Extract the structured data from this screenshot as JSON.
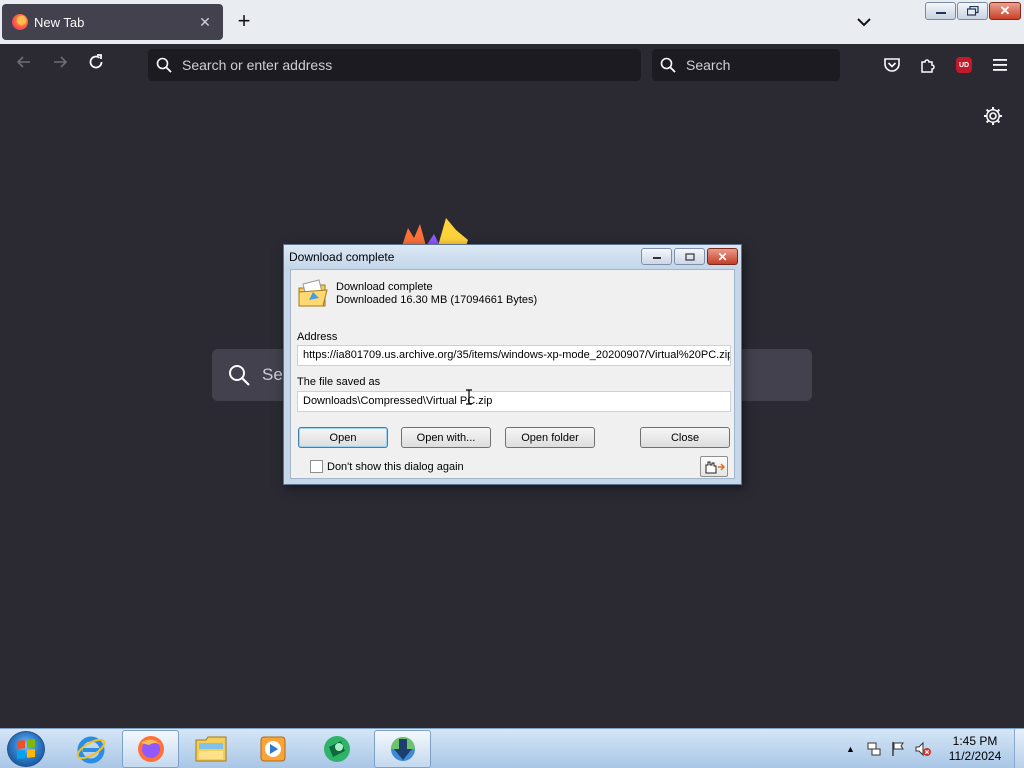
{
  "browser": {
    "tab": {
      "title": "New Tab",
      "close": "✕"
    },
    "new_tab": "+",
    "url_placeholder": "Search or enter address",
    "search_placeholder": "Search",
    "ublock_label": "UD",
    "newtab_search_placeholder": "Se",
    "window_close": "✕"
  },
  "dialog": {
    "title": "Download complete",
    "status": "Download complete",
    "details": "Downloaded 16.30  MB (17094661 Bytes)",
    "address_label": "Address",
    "address_value": "https://ia801709.us.archive.org/35/items/windows-xp-mode_20200907/Virtual%20PC.zip",
    "saved_label": "The file saved as",
    "saved_value": "Downloads\\Compressed\\Virtual PC.zip",
    "buttons": {
      "open": "Open",
      "open_with": "Open with...",
      "open_folder": "Open folder",
      "close": "Close"
    },
    "checkbox_label": "Don't show this dialog again",
    "close_glyph": "✕"
  },
  "taskbar": {
    "time": "1:45 PM",
    "date": "11/2/2024",
    "tray_expand": "▲"
  },
  "colors": {
    "browser_bg": "#2b2a33",
    "accent": "#0060df",
    "dialog_frame": "#c6d7ea"
  }
}
